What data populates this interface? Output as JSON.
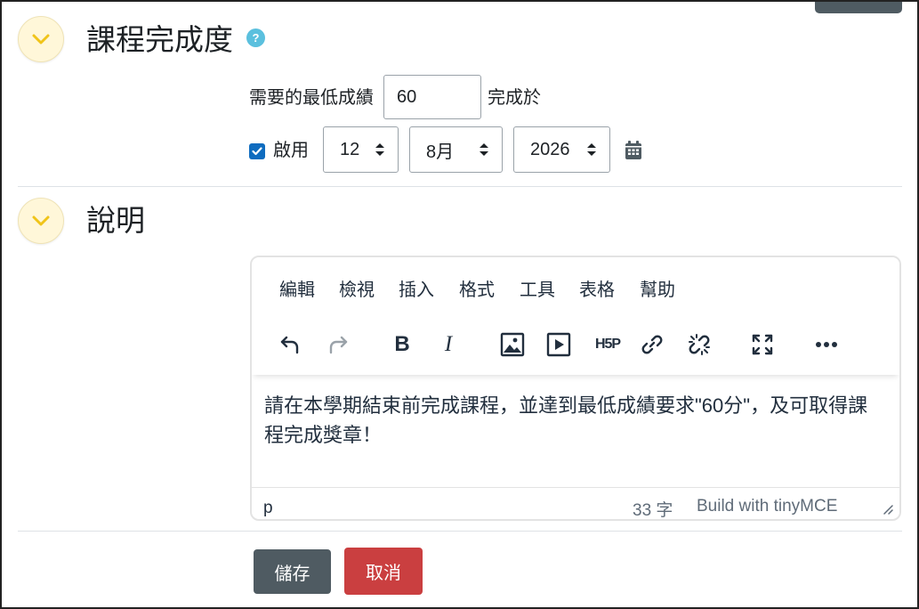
{
  "completion_section": {
    "title": "課程完成度",
    "help_icon": "?",
    "min_grade_label": "需要的最低成績",
    "min_grade_value": "60",
    "complete_on_label": "完成於",
    "enable_label": "啟用",
    "day": "12",
    "month": "8月",
    "year": "2026"
  },
  "description_section": {
    "title": "說明"
  },
  "editor": {
    "menu": [
      "編輯",
      "檢視",
      "插入",
      "格式",
      "工具",
      "表格",
      "幫助"
    ],
    "toolbar_icons": [
      "undo-icon",
      "redo-icon",
      "bold-icon",
      "italic-icon",
      "image-icon",
      "media-icon",
      "h5p-icon",
      "link-icon",
      "unlink-icon",
      "fullscreen-icon",
      "more-icon"
    ],
    "bold_glyph": "B",
    "italic_glyph": "I",
    "h5p_glyph": "H5P",
    "content": "請在本學期結束前完成課程，並達到最低成績要求\"60分\"，及可取得課程完成獎章！",
    "status_path": "p",
    "word_count": "33 字",
    "branding": "Build with tinyMCE"
  },
  "buttons": {
    "save": "儲存",
    "cancel": "取消"
  },
  "colors": {
    "save_button": "#4f5b62",
    "cancel_button": "#ca3f40",
    "checkbox": "#0f6cbf",
    "help_icon": "#5bc0de",
    "collapse_button": "#fff7d9",
    "chevron": "#f0c419"
  }
}
